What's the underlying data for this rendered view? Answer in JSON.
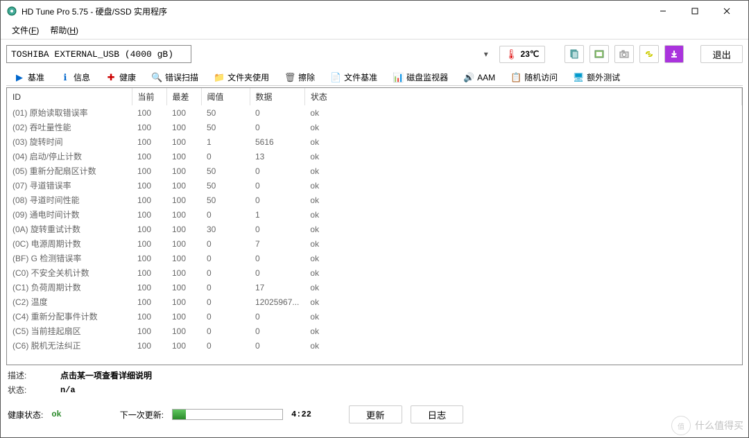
{
  "window": {
    "title": "HD Tune Pro 5.75 - 硬盘/SSD 实用程序"
  },
  "menu": {
    "file": "文件",
    "file_key": "F",
    "help": "帮助",
    "help_key": "H"
  },
  "device": {
    "selected": "TOSHIBA EXTERNAL_USB (4000 gB)",
    "temperature": "23℃"
  },
  "toolbar": {
    "exit": "退出",
    "icons": [
      "copy-icon",
      "screenshot-icon",
      "camera-icon",
      "link-icon",
      "download-icon"
    ]
  },
  "tabs": [
    {
      "icon": "▶",
      "color": "#0066cc",
      "label": "基准"
    },
    {
      "icon": "ℹ",
      "color": "#0066cc",
      "label": "信息"
    },
    {
      "icon": "✚",
      "color": "#cc0000",
      "label": "健康"
    },
    {
      "icon": "🔍",
      "color": "#2a8a2a",
      "label": "错误扫描"
    },
    {
      "icon": "📁",
      "color": "#d9a400",
      "label": "文件夹使用"
    },
    {
      "icon": "🗑",
      "color": "#555",
      "label": "擦除"
    },
    {
      "icon": "📄",
      "color": "#cc0000",
      "label": "文件基准"
    },
    {
      "icon": "📊",
      "color": "#2a8a2a",
      "label": "磁盘监视器"
    },
    {
      "icon": "🔊",
      "color": "#d9a400",
      "label": "AAM"
    },
    {
      "icon": "📋",
      "color": "#d9a400",
      "label": "随机访问"
    },
    {
      "icon": "🖥",
      "color": "#0099cc",
      "label": "额外测试"
    }
  ],
  "table": {
    "headers": {
      "id": "ID",
      "current": "当前",
      "worst": "最差",
      "threshold": "阈值",
      "data": "数据",
      "status": "状态"
    },
    "rows": [
      {
        "id": "(01) 原始读取错误率",
        "cur": "100",
        "wst": "100",
        "thr": "50",
        "dat": "0",
        "sts": "ok"
      },
      {
        "id": "(02) 吞吐量性能",
        "cur": "100",
        "wst": "100",
        "thr": "50",
        "dat": "0",
        "sts": "ok"
      },
      {
        "id": "(03) 旋转时间",
        "cur": "100",
        "wst": "100",
        "thr": "1",
        "dat": "5616",
        "sts": "ok"
      },
      {
        "id": "(04) 启动/停止计数",
        "cur": "100",
        "wst": "100",
        "thr": "0",
        "dat": "13",
        "sts": "ok"
      },
      {
        "id": "(05) 重新分配扇区计数",
        "cur": "100",
        "wst": "100",
        "thr": "50",
        "dat": "0",
        "sts": "ok"
      },
      {
        "id": "(07) 寻道错误率",
        "cur": "100",
        "wst": "100",
        "thr": "50",
        "dat": "0",
        "sts": "ok"
      },
      {
        "id": "(08) 寻道时间性能",
        "cur": "100",
        "wst": "100",
        "thr": "50",
        "dat": "0",
        "sts": "ok"
      },
      {
        "id": "(09) 通电时间计数",
        "cur": "100",
        "wst": "100",
        "thr": "0",
        "dat": "1",
        "sts": "ok"
      },
      {
        "id": "(0A) 旋转重试计数",
        "cur": "100",
        "wst": "100",
        "thr": "30",
        "dat": "0",
        "sts": "ok"
      },
      {
        "id": "(0C) 电源周期计数",
        "cur": "100",
        "wst": "100",
        "thr": "0",
        "dat": "7",
        "sts": "ok"
      },
      {
        "id": "(BF) G 检测错误率",
        "cur": "100",
        "wst": "100",
        "thr": "0",
        "dat": "0",
        "sts": "ok"
      },
      {
        "id": "(C0) 不安全关机计数",
        "cur": "100",
        "wst": "100",
        "thr": "0",
        "dat": "0",
        "sts": "ok"
      },
      {
        "id": "(C1) 负荷周期计数",
        "cur": "100",
        "wst": "100",
        "thr": "0",
        "dat": "17",
        "sts": "ok"
      },
      {
        "id": "(C2) 温度",
        "cur": "100",
        "wst": "100",
        "thr": "0",
        "dat": "12025967...",
        "sts": "ok"
      },
      {
        "id": "(C4) 重新分配事件计数",
        "cur": "100",
        "wst": "100",
        "thr": "0",
        "dat": "0",
        "sts": "ok"
      },
      {
        "id": "(C5) 当前挂起扇区",
        "cur": "100",
        "wst": "100",
        "thr": "0",
        "dat": "0",
        "sts": "ok"
      },
      {
        "id": "(C6) 脱机无法纠正",
        "cur": "100",
        "wst": "100",
        "thr": "0",
        "dat": "0",
        "sts": "ok"
      }
    ]
  },
  "description": {
    "label": "描述:",
    "value": "点击某一项查看详细说明"
  },
  "status": {
    "label": "状态:",
    "value": "n/a"
  },
  "health": {
    "label": "健康状态:",
    "value": "ok"
  },
  "nextUpdate": {
    "label": "下一次更新:",
    "time": "4:22"
  },
  "buttons": {
    "refresh": "更新",
    "log": "日志"
  },
  "watermark": "什么值得买"
}
